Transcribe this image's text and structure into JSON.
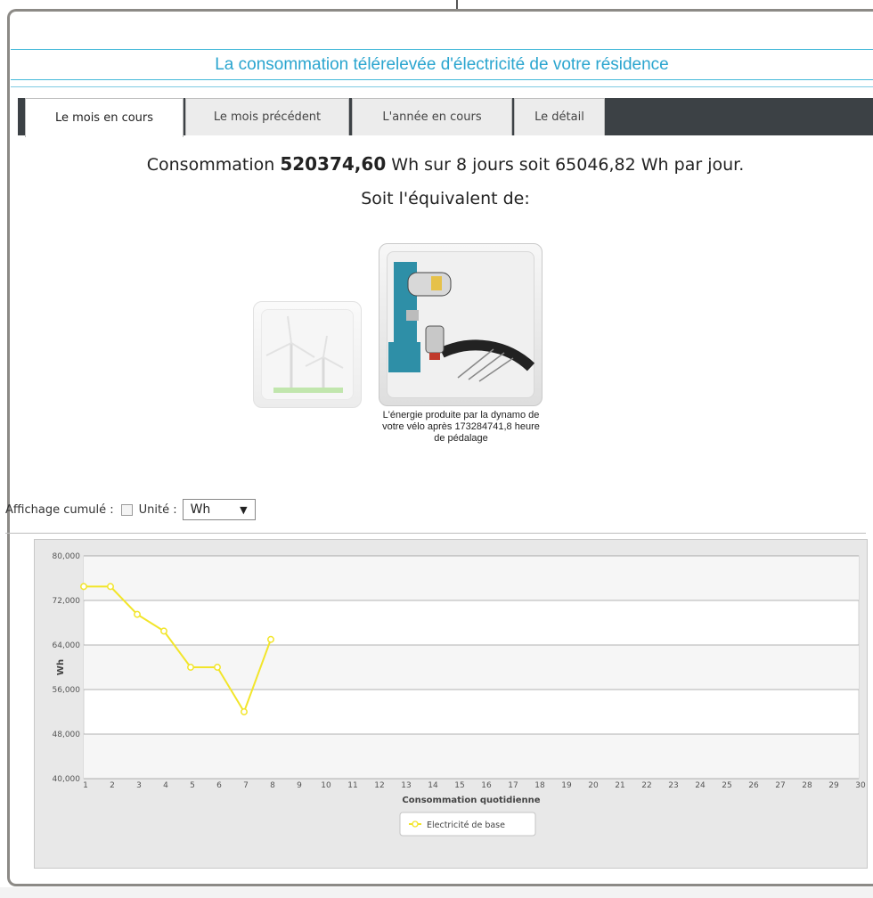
{
  "header": {
    "title": "La consommation télérelevée d'électricité de votre résidence"
  },
  "tabs": [
    {
      "label": "Le mois en cours",
      "active": true
    },
    {
      "label": "Le mois précédent",
      "active": false
    },
    {
      "label": "L'année en cours",
      "active": false
    },
    {
      "label": "Le détail",
      "active": false
    }
  ],
  "summary": {
    "prefix": "Consommation",
    "total": "520374,60",
    "rest": "Wh sur 8 jours soit 65046,82 Wh par jour.",
    "equivalent": "Soit l'équivalent de:"
  },
  "equivalents": [
    {
      "icon": "wind-turbine-icon",
      "selected": false
    },
    {
      "icon": "bicycle-dynamo-icon",
      "selected": true,
      "caption": "L'énergie produite par la dynamo de votre vélo après 173284741,8 heure de pédalage"
    }
  ],
  "controls": {
    "cumulative_label": "Affichage cumulé :",
    "cumulative_checked": false,
    "unit_label": "Unité :",
    "unit_value": "Wh"
  },
  "colors": {
    "title": "#2aa5cf",
    "tab_bar": "#3c4145",
    "series_line": "#f2e52a"
  },
  "chart_data": {
    "type": "line",
    "xlabel": "Consommation quotidienne",
    "ylabel": "Wh",
    "ylim": [
      40000,
      80000
    ],
    "yticks": [
      "40,000",
      "48,000",
      "56,000",
      "64,000",
      "72,000",
      "80,000"
    ],
    "ytick_values": [
      40000,
      48000,
      56000,
      64000,
      72000,
      80000
    ],
    "x": [
      1,
      2,
      3,
      4,
      5,
      6,
      7,
      8,
      9,
      10,
      11,
      12,
      13,
      14,
      15,
      16,
      17,
      18,
      19,
      20,
      21,
      22,
      23,
      24,
      25,
      26,
      27,
      28,
      29,
      30
    ],
    "series": [
      {
        "name": "Electricité de base",
        "x": [
          1,
          2,
          3,
          4,
          5,
          6,
          7,
          8
        ],
        "values": [
          74500,
          74500,
          69500,
          66500,
          60000,
          60000,
          52000,
          65000
        ]
      }
    ],
    "legend": "bottom-center",
    "grid": true
  }
}
